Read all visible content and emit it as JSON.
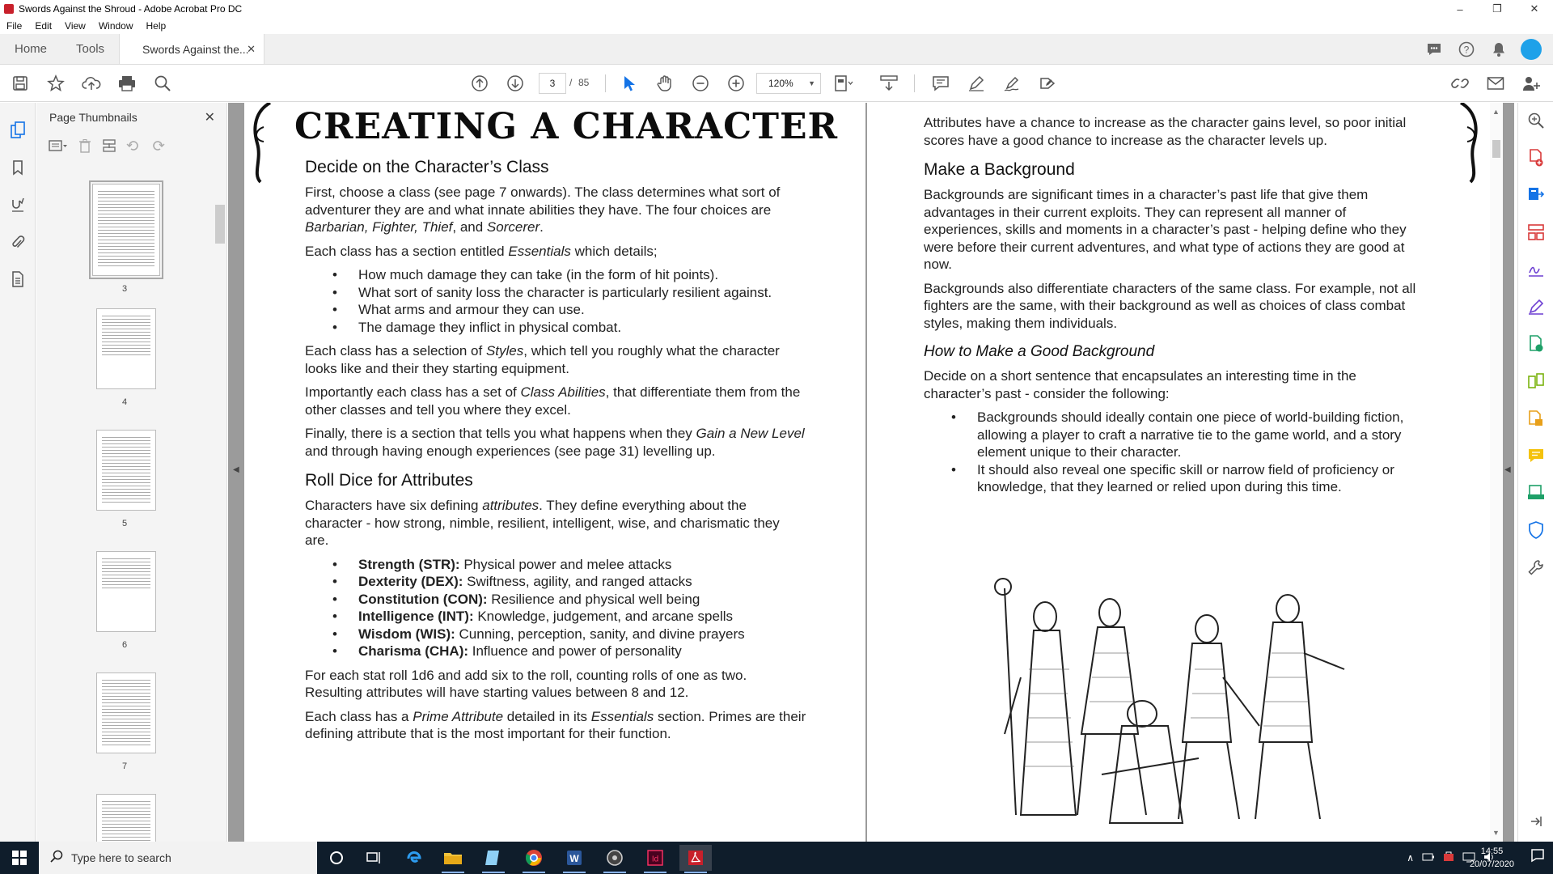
{
  "window": {
    "title": "Swords Against the Shroud - Adobe Acrobat Pro DC",
    "minimize": "–",
    "restore": "❐",
    "close": "✕"
  },
  "menu": [
    "File",
    "Edit",
    "View",
    "Window",
    "Help"
  ],
  "tabs": {
    "home": "Home",
    "tools": "Tools",
    "document": "Swords Against the...",
    "close": "✕"
  },
  "toolbar": {
    "current_page": "3",
    "page_separator": "/",
    "total_pages": "85",
    "zoom": "120%"
  },
  "thumbnails": {
    "title": "Page Thumbnails",
    "close": "✕",
    "pages": [
      "3",
      "4",
      "5",
      "6",
      "7"
    ]
  },
  "page_left": {
    "chapter_title": "CREATING A CHARACTER",
    "h_class": "Decide on the Character’s Class",
    "p1_a": "First, choose a class (see page 7 onwards). The class determines what sort of adventurer they are and what innate abilities they have. The four choices are ",
    "p1_italic": "Barbarian, Fighter, Thief",
    "p1_b": ", and ",
    "p1_italic2": "Sorcerer",
    "p1_c": ".",
    "p2_a": "Each class has a section entitled ",
    "p2_italic": "Essentials",
    "p2_b": " which details;",
    "essentials_list": [
      "How much damage they can take (in the form of hit points).",
      "What sort of sanity loss the character is particularly resilient against.",
      "What arms and armour they can use.",
      "The damage they inflict in physical combat."
    ],
    "p3_a": "Each class has a selection of ",
    "p3_italic": "Styles",
    "p3_b": ", which tell you roughly what the character looks like and their they starting equipment.",
    "p4_a": "Importantly each class has a set of ",
    "p4_italic": "Class Abilities",
    "p4_b": ", that differentiate them from the other classes and tell you where they excel.",
    "p5_a": "Finally, there is a section that tells you what happens when they ",
    "p5_italic": "Gain a New Level",
    "p5_b": " and through having enough experiences (see page 31) levelling up.",
    "h_attr": "Roll Dice for Attributes",
    "p6_a": "Characters have six defining ",
    "p6_italic": "attributes",
    "p6_b": ". They define everything about the character - how strong, nimble, resilient, intelligent, wise, and charismatic they are.",
    "attributes": [
      {
        "name": "Strength (STR):",
        "desc": " Physical power and melee attacks"
      },
      {
        "name": "Dexterity (DEX):",
        "desc": " Swiftness, agility, and ranged attacks"
      },
      {
        "name": "Constitution (CON):",
        "desc": " Resilience and physical well being"
      },
      {
        "name": "Intelligence (INT):",
        "desc": " Knowledge, judgement, and arcane spells"
      },
      {
        "name": "Wisdom (WIS):",
        "desc": " Cunning, perception, sanity, and divine prayers"
      },
      {
        "name": "Charisma (CHA):",
        "desc": " Influence and power of personality"
      }
    ],
    "p7": "For each stat roll 1d6 and add six to the roll, counting rolls of one as two. Resulting attributes will have starting values between 8 and 12.",
    "p8_a": "Each class has a ",
    "p8_italic": "Prime Attribute",
    "p8_b": " detailed in its ",
    "p8_italic2": "Essentials",
    "p8_c": " section. Primes are their defining attribute that is the most important for their function."
  },
  "page_right": {
    "p1": "Attributes have a chance to increase as the character gains level, so poor initial scores have a good chance to increase as the character levels up.",
    "h_bg": "Make a Background",
    "p2": "Backgrounds are significant times in a character’s past life that give them advantages in their current exploits. They can represent all manner of experiences, skills and moments in a character’s past - helping define who they were before their current adventures, and what type of actions they are good at now.",
    "p3": "Backgrounds also differentiate characters of the same class. For example, not all fighters are the same, with their background as well as choices of class combat styles, making them individuals.",
    "h_good": "How to Make a Good Background",
    "p4": "Decide on a short sentence that encapsulates an interesting time in the character’s past - consider the following:",
    "bg_list": [
      "Backgrounds should ideally contain one piece of world-building fiction, allowing a player to craft a narrative tie to the game world, and a story element unique to their character.",
      "It should also reveal one specific skill or narrow field of proficiency or knowledge, that they learned or relied upon during this time."
    ]
  },
  "taskbar": {
    "search_placeholder": "Type here to search",
    "time": "14:55",
    "date": "20/07/2020"
  },
  "colors": {
    "accent": "#1473e6",
    "acrobat_red": "#c8202b",
    "taskbar": "#0f1d2b",
    "doc_background": "#9b9b9b"
  }
}
